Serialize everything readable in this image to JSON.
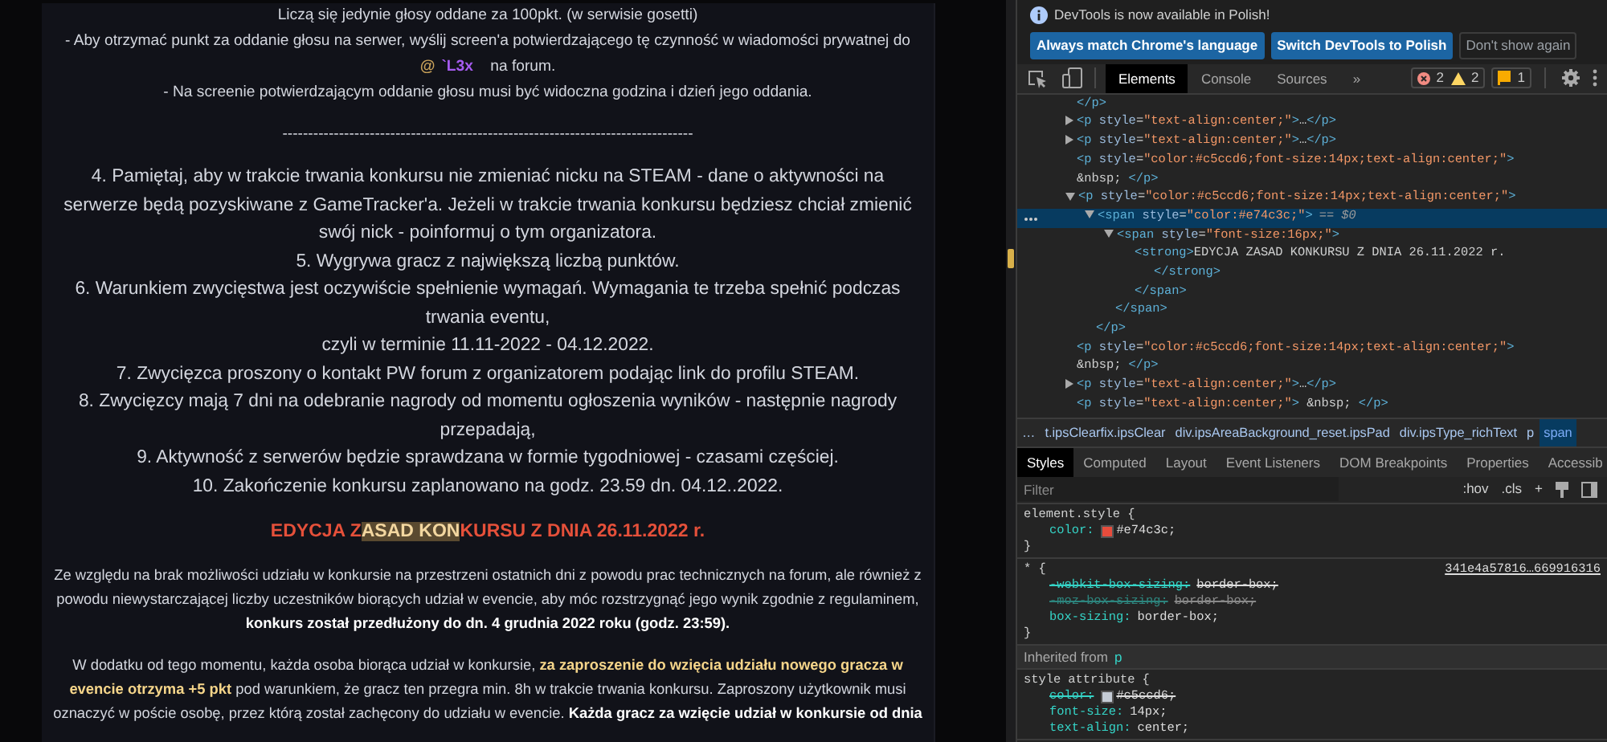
{
  "post": {
    "sections": [
      [
        {
          "kind": "line",
          "text": "Liczą się jedynie głosy oddane za 100pkt. (w serwisie gosetti)"
        },
        {
          "kind": "line",
          "text": "- Aby otrzymać punkt za oddanie głosu na serwer, wyślij screen'a potwierdzającego tę czynność w wiadomości prywatnej do"
        },
        {
          "kind": "mention",
          "at": "@",
          "mention": "`L3x",
          "text": "na forum."
        },
        {
          "kind": "line",
          "text": "- Na screenie potwierdzającym oddanie głosu musi być widoczna godzina i dzień jego oddania."
        }
      ],
      [
        {
          "kind": "line",
          "text": "--------------------------------------------------------------------------------"
        }
      ],
      [
        {
          "kind": "item",
          "text": "4. Pamiętaj, aby w trakcie trwania konkursu nie zmieniać nicku na STEAM - dane o aktywności na serwerze będą pozyskiwane z GameTracker'a. Jeżeli w trakcie trwania konkursu będziesz chciał zmienić swój nick - poinformuj o tym organizatora."
        },
        {
          "kind": "item",
          "text": "5. Wygrywa gracz z największą liczbą punktów."
        },
        {
          "kind": "item",
          "text": "6. Warunkiem zwycięstwa jest oczywiście spełnienie wymagań. Wymagania te trzeba spełnić podczas trwania eventu,"
        },
        {
          "kind": "item",
          "text": "czyli w terminie 11.11-2022 - 04.12.2022."
        },
        {
          "kind": "item",
          "text": "7. Zwycięzca proszony o kontakt PW forum z organizatorem podając link do profilu STEAM."
        },
        {
          "kind": "item",
          "text": "8. Zwycięzcy mają 7 dni na odebranie nagrody od momentu ogłoszenia wyników - następnie nagrody przepadają,"
        },
        {
          "kind": "item",
          "text": "9. Aktywność z serwerów będzie sprawdzana w formie tygodniowej - czasami częściej."
        },
        {
          "kind": "item",
          "text": "10. Zakończenie konkursu zaplanowano na godz. 23.59 dn. 04.12..2022."
        }
      ],
      [
        {
          "kind": "heading",
          "segments": [
            {
              "text": "EDYCJA Z",
              "highlighted": false
            },
            {
              "text": "ASAD KON",
              "highlighted": true
            },
            {
              "text": "KURSU Z DNIA 26.11.2022 r.",
              "highlighted": false
            }
          ]
        }
      ],
      [
        {
          "kind": "paragraph",
          "segments": [
            {
              "text": "Ze względu na brak możliwości udziału w konkursie na przestrzeni ostatnich dni z powodu prac technicznych na forum, ale również z powodu niewystarczającej liczby uczestników biorących udział w evencie, aby móc rozstrzygnąć jego wynik zgodnie z regulaminem, ",
              "kind": "normal"
            },
            {
              "text": "konkurs został przedłużony do dn. 4 grudnia 2022 roku (godz. 23:59).",
              "kind": "bold"
            }
          ]
        }
      ],
      [
        {
          "kind": "paragraph",
          "segments": [
            {
              "text": "W dodatku od tego momentu, każda osoba biorąca udział w konkursie, ",
              "kind": "normal"
            },
            {
              "text": "za zaproszenie do wzięcia udziału nowego gracza w evencie otrzyma +5 pkt",
              "kind": "accent"
            },
            {
              "text": " pod warunkiem, że gracz ten przegra min. 8h w trakcie trwania konkursu. Zaproszony użytkownik musi oznaczyć w poście osobę, przez którą został zachęcony do udziału w evencie. ",
              "kind": "normal"
            },
            {
              "text": "Każda gracz za wzięcie udział w konkursie od dnia",
              "kind": "bold"
            }
          ]
        }
      ]
    ]
  },
  "devtools": {
    "infobar": {
      "message": "DevTools is now available in Polish!",
      "buttons": [
        {
          "label": "Always match Chrome's language",
          "kind": "primary"
        },
        {
          "label": "Switch DevTools to Polish",
          "kind": "primary"
        },
        {
          "label": "Don't show again",
          "kind": "secondary"
        }
      ]
    },
    "tabs": [
      {
        "label": "Elements",
        "selected": true
      },
      {
        "label": "Console",
        "selected": false
      },
      {
        "label": "Sources",
        "selected": false
      }
    ],
    "more_tabs": "»",
    "counts": {
      "errors": "2",
      "warnings": "2",
      "issues": "1"
    },
    "dom_tree": [
      {
        "markup": "</p>",
        "selected": false
      },
      {
        "markup": "<p style=\"text-align:center;\">…</p>",
        "expanded": false,
        "selected": false
      },
      {
        "markup": "<p style=\"text-align:center;\">…</p>",
        "expanded": false,
        "selected": false
      },
      {
        "markup": "<p style=\"color:#c5ccd6;font-size:14px;text-align:center;\">",
        "selected": false
      },
      {
        "markup": "&nbsp; </p>",
        "selected": false
      },
      {
        "markup": "<p style=\"color:#c5ccd6;font-size:14px;text-align:center;\">",
        "expanded": true,
        "selected": false,
        "children": [
          {
            "markup": "<span style=\"color:#e74c3c;\">",
            "suffix": "== $0",
            "expanded": true,
            "selected": true,
            "children": [
              {
                "markup": "<span style=\"font-size:16px;\">",
                "expanded": true,
                "selected": false,
                "children": [
                  {
                    "markup": "<strong>EDYCJA ZASAD KONKURSU Z DNIA 26.11.2022 r.",
                    "selected": false,
                    "children": [
                      {
                        "markup": "</strong>",
                        "selected": false
                      }
                    ]
                  },
                  {
                    "markup": "</span>",
                    "selected": false
                  }
                ]
              },
              {
                "markup": "</span>",
                "selected": false
              }
            ]
          },
          {
            "markup": "</p>",
            "selected": false
          }
        ]
      },
      {
        "markup": "<p style=\"color:#c5ccd6;font-size:14px;text-align:center;\">",
        "selected": false
      },
      {
        "markup": "&nbsp; </p>",
        "selected": false
      },
      {
        "markup": "<p style=\"text-align:center;\">…</p>",
        "expanded": false,
        "selected": false
      },
      {
        "markup": "<p style=\"text-align:center;\"> &nbsp; </p>",
        "selected": false
      }
    ],
    "breadcrumbs": [
      {
        "label": "…",
        "selected": false
      },
      {
        "label": "t.ipsClearfix.ipsClear",
        "selected": false
      },
      {
        "label": "div.ipsAreaBackground_reset.ipsPad",
        "selected": false
      },
      {
        "label": "div.ipsType_richText",
        "selected": false
      },
      {
        "label": "p",
        "selected": false
      },
      {
        "label": "span",
        "selected": true
      }
    ],
    "pane_tabs": [
      {
        "label": "Styles",
        "selected": true
      },
      {
        "label": "Computed",
        "selected": false
      },
      {
        "label": "Layout",
        "selected": false
      },
      {
        "label": "Event Listeners",
        "selected": false
      },
      {
        "label": "DOM Breakpoints",
        "selected": false
      },
      {
        "label": "Properties",
        "selected": false
      },
      {
        "label": "Accessib",
        "selected": false
      }
    ],
    "filter": {
      "placeholder": "Filter",
      "hov": ":hov",
      "cls": ".cls",
      "add": "+"
    },
    "rules": [
      {
        "kind": "rule",
        "selector": "element.style {",
        "close": "}",
        "properties": [
          {
            "name": "color:",
            "value": "#e74c3c;",
            "swatch": true,
            "overridden": false,
            "inactive": false
          }
        ]
      },
      {
        "kind": "rule",
        "selector": "* {",
        "source": "341e4a57816…669916316",
        "close": "}",
        "properties": [
          {
            "name": "-webkit-box-sizing:",
            "value": "border-box;",
            "overridden": true,
            "inactive": false
          },
          {
            "name": "-moz-box-sizing:",
            "value": "border-box;",
            "overridden": true,
            "inactive": true
          },
          {
            "name": "box-sizing:",
            "value": "border-box;",
            "overridden": false,
            "inactive": false
          }
        ]
      },
      {
        "kind": "inherited",
        "label": "Inherited from",
        "element": "p"
      },
      {
        "kind": "rule",
        "selector": "style attribute {",
        "properties": [
          {
            "name": "color:",
            "value": "#c5ccd6;",
            "swatch": true,
            "overridden": true,
            "inactive": false
          },
          {
            "name": "font-size:",
            "value": "14px;",
            "overridden": false,
            "inactive": false
          },
          {
            "name": "text-align:",
            "value": "center;",
            "overridden": false,
            "inactive": false
          }
        ]
      }
    ]
  }
}
